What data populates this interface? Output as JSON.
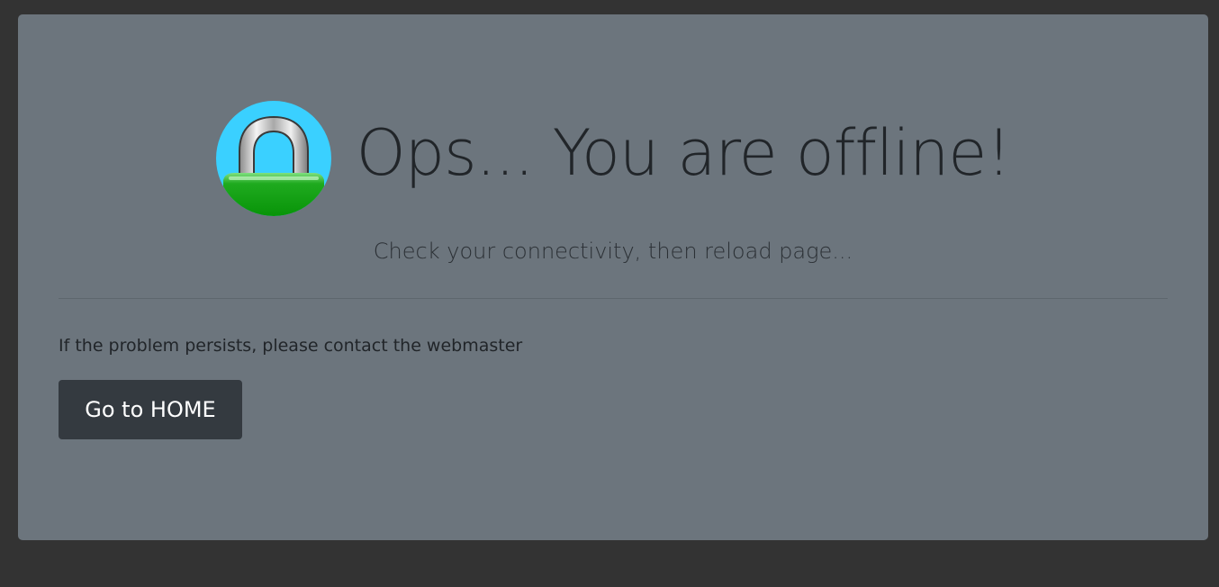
{
  "page": {
    "background_color": "#333333",
    "panel_color": "#6c757d"
  },
  "hero": {
    "icon": "padlock-icon",
    "title": "Ops... You are offline!",
    "lead": "Check your connectivity, then reload page..."
  },
  "content": {
    "hint": "If the problem persists, please contact the webmaster",
    "home_button_label": "Go to HOME"
  }
}
